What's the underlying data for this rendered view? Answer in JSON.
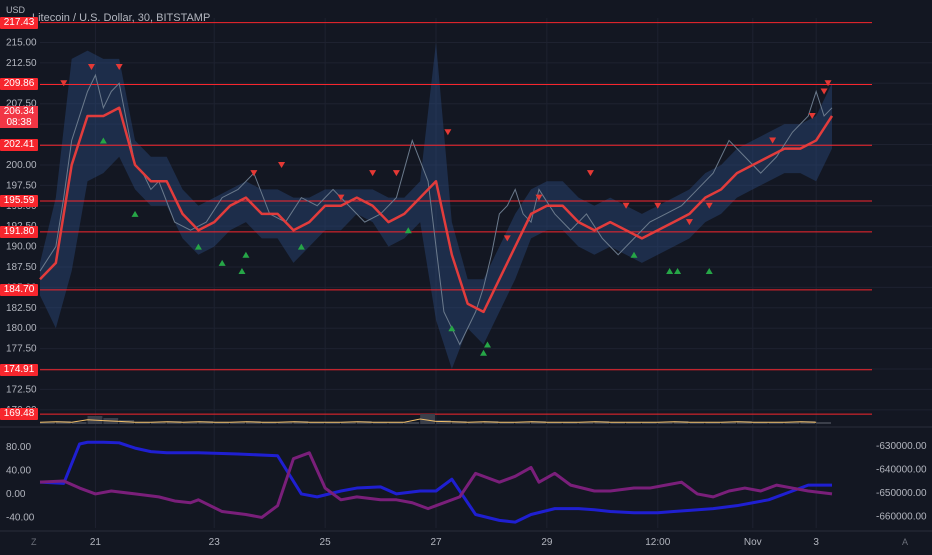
{
  "header": {
    "title": "Litecoin / U.S. Dollar, 30, BITSTAMP",
    "currency": "USD"
  },
  "price_axis": {
    "current_price": "206.34",
    "countdown": "08:38"
  },
  "bottom_bar": {
    "left_button": "Z",
    "right_button": "A"
  },
  "colors": {
    "background": "#131722",
    "grid": "#1e2230",
    "level_lines": "#f7262d",
    "ema": "#e23c3c",
    "band": "#2b4a7d",
    "price_line": "#6b7a8c",
    "sell_marker": "#e53935",
    "buy_marker": "#26a647",
    "volume": "#f2c06b",
    "osc_blue": "#1f1fd1",
    "osc_purple": "#7a1f7a"
  },
  "chart_data": [
    {
      "type": "line",
      "name_hint": "main price panel",
      "x_ticks": [
        "21",
        "23",
        "25",
        "27",
        "29",
        "12:00",
        "Nov",
        "3"
      ],
      "y_ticks": [
        215.0,
        212.5,
        210.0,
        207.5,
        205.0,
        202.5,
        200.0,
        197.5,
        195.0,
        192.5,
        190.0,
        187.5,
        185.0,
        182.5,
        180.0,
        177.5,
        175.0,
        172.5,
        170.0
      ],
      "ylim": [
        169.0,
        218.0
      ],
      "xlim": [
        0,
        100
      ],
      "horizontal_levels": [
        217.43,
        209.86,
        202.41,
        195.59,
        191.8,
        184.7,
        174.91,
        169.48
      ],
      "series": [
        {
          "role": "price",
          "x": [
            0,
            2,
            3,
            4,
            5,
            6,
            7,
            8,
            9,
            10,
            11,
            12,
            13,
            14,
            15,
            17,
            19,
            21,
            23,
            25,
            27,
            29,
            31,
            33,
            35,
            37,
            39,
            41,
            43,
            45,
            47,
            49,
            51,
            53,
            55,
            56,
            57,
            58,
            59,
            60,
            61,
            62,
            63,
            65,
            67,
            69,
            71,
            73,
            75,
            77,
            79,
            81,
            83,
            85,
            87,
            89,
            91,
            93,
            95,
            97,
            98,
            99,
            100
          ],
          "y": [
            187,
            190,
            196,
            203,
            206,
            209,
            211,
            207,
            209,
            210,
            205,
            200,
            199,
            197,
            198,
            193,
            192,
            193,
            196,
            197,
            199,
            194,
            193,
            196,
            195,
            197,
            195,
            193,
            194,
            196,
            203,
            198,
            182,
            178,
            182,
            185,
            189,
            194,
            195,
            197,
            194,
            193,
            197,
            194,
            192,
            194,
            191,
            189,
            191,
            193,
            194,
            195,
            197,
            199,
            203,
            201,
            199,
            201,
            204,
            206,
            209,
            206,
            207
          ]
        },
        {
          "role": "ema",
          "x": [
            0,
            2,
            4,
            6,
            8,
            10,
            12,
            14,
            16,
            18,
            20,
            22,
            24,
            26,
            28,
            30,
            32,
            34,
            36,
            38,
            40,
            42,
            44,
            46,
            48,
            50,
            52,
            54,
            56,
            58,
            60,
            62,
            64,
            66,
            68,
            70,
            72,
            74,
            76,
            78,
            80,
            82,
            84,
            86,
            88,
            90,
            92,
            94,
            96,
            98,
            100
          ],
          "y": [
            186,
            188,
            200,
            206,
            206,
            207,
            200,
            198,
            198,
            194,
            192,
            193,
            195,
            196,
            194,
            194,
            192,
            193,
            195,
            195,
            196,
            195,
            193,
            194,
            196,
            198,
            189,
            183,
            182,
            186,
            190,
            194,
            195,
            195,
            193,
            192,
            193,
            192,
            191,
            192,
            193,
            194,
            196,
            197,
            199,
            200,
            201,
            202,
            202,
            203,
            206
          ]
        },
        {
          "role": "band_upper",
          "x": [
            0,
            2,
            4,
            6,
            8,
            10,
            12,
            14,
            16,
            18,
            20,
            22,
            24,
            26,
            28,
            30,
            32,
            34,
            36,
            38,
            40,
            42,
            44,
            46,
            48,
            50,
            52,
            54,
            56,
            58,
            60,
            62,
            64,
            66,
            68,
            70,
            72,
            74,
            76,
            78,
            80,
            82,
            84,
            86,
            88,
            90,
            92,
            94,
            96,
            98,
            100
          ],
          "y": [
            188,
            196,
            213,
            214,
            213,
            213,
            203,
            201,
            201,
            197,
            195,
            196,
            197,
            198,
            197,
            197,
            196,
            196,
            197,
            197,
            197,
            197,
            196,
            196,
            198,
            215,
            193,
            186,
            186,
            190,
            194,
            197,
            198,
            198,
            196,
            195,
            196,
            195,
            194,
            195,
            196,
            197,
            199,
            200,
            202,
            203,
            204,
            205,
            205,
            206,
            210
          ]
        },
        {
          "role": "band_lower",
          "x": [
            0,
            2,
            4,
            6,
            8,
            10,
            12,
            14,
            16,
            18,
            20,
            22,
            24,
            26,
            28,
            30,
            32,
            34,
            36,
            38,
            40,
            42,
            44,
            46,
            48,
            50,
            52,
            54,
            56,
            58,
            60,
            62,
            64,
            66,
            68,
            70,
            72,
            74,
            76,
            78,
            80,
            82,
            84,
            86,
            88,
            90,
            92,
            94,
            96,
            98,
            100
          ],
          "y": [
            184,
            180,
            187,
            198,
            199,
            201,
            197,
            195,
            195,
            191,
            189,
            190,
            192,
            193,
            191,
            191,
            188,
            190,
            192,
            192,
            194,
            193,
            190,
            191,
            193,
            181,
            175,
            180,
            178,
            182,
            186,
            191,
            192,
            192,
            190,
            189,
            190,
            189,
            188,
            189,
            190,
            191,
            193,
            194,
            196,
            197,
            198,
            199,
            199,
            198,
            202
          ]
        }
      ],
      "sell_markers": [
        {
          "x": 3,
          "y": 210
        },
        {
          "x": 6.5,
          "y": 212
        },
        {
          "x": 10,
          "y": 212
        },
        {
          "x": 27,
          "y": 199
        },
        {
          "x": 30.5,
          "y": 200
        },
        {
          "x": 38,
          "y": 196
        },
        {
          "x": 42,
          "y": 199
        },
        {
          "x": 45,
          "y": 199
        },
        {
          "x": 51.5,
          "y": 204
        },
        {
          "x": 59,
          "y": 191
        },
        {
          "x": 63,
          "y": 196
        },
        {
          "x": 69.5,
          "y": 199
        },
        {
          "x": 74,
          "y": 195
        },
        {
          "x": 78,
          "y": 195
        },
        {
          "x": 82,
          "y": 193
        },
        {
          "x": 84.5,
          "y": 195
        },
        {
          "x": 92.5,
          "y": 203
        },
        {
          "x": 97.5,
          "y": 206
        },
        {
          "x": 99,
          "y": 209
        },
        {
          "x": 99.5,
          "y": 210
        }
      ],
      "buy_markers": [
        {
          "x": 8,
          "y": 203
        },
        {
          "x": 12,
          "y": 194
        },
        {
          "x": 20,
          "y": 190
        },
        {
          "x": 23,
          "y": 188
        },
        {
          "x": 25.5,
          "y": 187
        },
        {
          "x": 26,
          "y": 189
        },
        {
          "x": 33,
          "y": 190
        },
        {
          "x": 46.5,
          "y": 192
        },
        {
          "x": 52,
          "y": 180
        },
        {
          "x": 56,
          "y": 177
        },
        {
          "x": 56.5,
          "y": 178
        },
        {
          "x": 75,
          "y": 189
        },
        {
          "x": 79.5,
          "y": 187
        },
        {
          "x": 80.5,
          "y": 187
        },
        {
          "x": 84.5,
          "y": 187
        }
      ]
    },
    {
      "type": "line",
      "name_hint": "oscillator panel",
      "left_y_ticks": [
        80.0,
        40.0,
        0.0,
        -40.0
      ],
      "right_y_ticks": [
        -630000.0,
        -640000.0,
        -650000.0,
        -660000.0
      ],
      "left_ylim": [
        -58,
        102
      ],
      "right_ylim": [
        -665000,
        -625000
      ],
      "series": [
        {
          "role": "blue",
          "x": [
            0,
            3,
            5,
            6,
            8,
            10,
            12,
            14,
            16,
            20,
            25,
            30,
            33,
            35,
            38,
            40,
            43,
            45,
            48,
            50,
            52,
            55,
            58,
            60,
            62,
            65,
            68,
            70,
            72,
            75,
            78,
            80,
            82,
            85,
            88,
            90,
            92,
            95,
            97,
            100
          ],
          "y": [
            20,
            18,
            85,
            88,
            88,
            87,
            78,
            72,
            70,
            70,
            68,
            65,
            0,
            -5,
            5,
            10,
            12,
            0,
            5,
            5,
            25,
            -35,
            -45,
            -48,
            -35,
            -25,
            -25,
            -27,
            -30,
            -32,
            -32,
            -30,
            -28,
            -25,
            -20,
            -15,
            -10,
            5,
            15,
            15
          ]
        },
        {
          "role": "purple",
          "x": [
            0,
            3,
            5,
            7,
            9,
            12,
            15,
            17,
            19,
            20,
            23,
            26,
            28,
            30,
            32,
            34,
            36,
            38,
            40,
            43,
            45,
            47,
            49,
            50,
            53,
            55,
            58,
            60,
            62,
            63,
            65,
            67,
            70,
            72,
            75,
            77,
            79,
            81,
            83,
            85,
            87,
            89,
            91,
            93,
            95,
            97,
            100
          ],
          "y": [
            20,
            22,
            10,
            0,
            5,
            0,
            -5,
            -12,
            -15,
            -10,
            -30,
            -35,
            -40,
            -20,
            60,
            70,
            10,
            -10,
            -5,
            -10,
            -10,
            -15,
            -25,
            -20,
            -5,
            35,
            20,
            30,
            45,
            20,
            35,
            15,
            5,
            5,
            10,
            10,
            15,
            20,
            0,
            -5,
            5,
            10,
            5,
            15,
            10,
            5,
            0
          ]
        }
      ]
    },
    {
      "type": "bar",
      "name_hint": "volume strip",
      "values": [
        2,
        3,
        2,
        8,
        6,
        4,
        2,
        2,
        3,
        2,
        3,
        2,
        2,
        3,
        2,
        2,
        3,
        2,
        2,
        2,
        3,
        2,
        2,
        2,
        10,
        4,
        3,
        2,
        3,
        2,
        2,
        3,
        2,
        2,
        2,
        3,
        2,
        2,
        2,
        2,
        3,
        2,
        2,
        2,
        3,
        2,
        2,
        2,
        3,
        2
      ]
    }
  ]
}
